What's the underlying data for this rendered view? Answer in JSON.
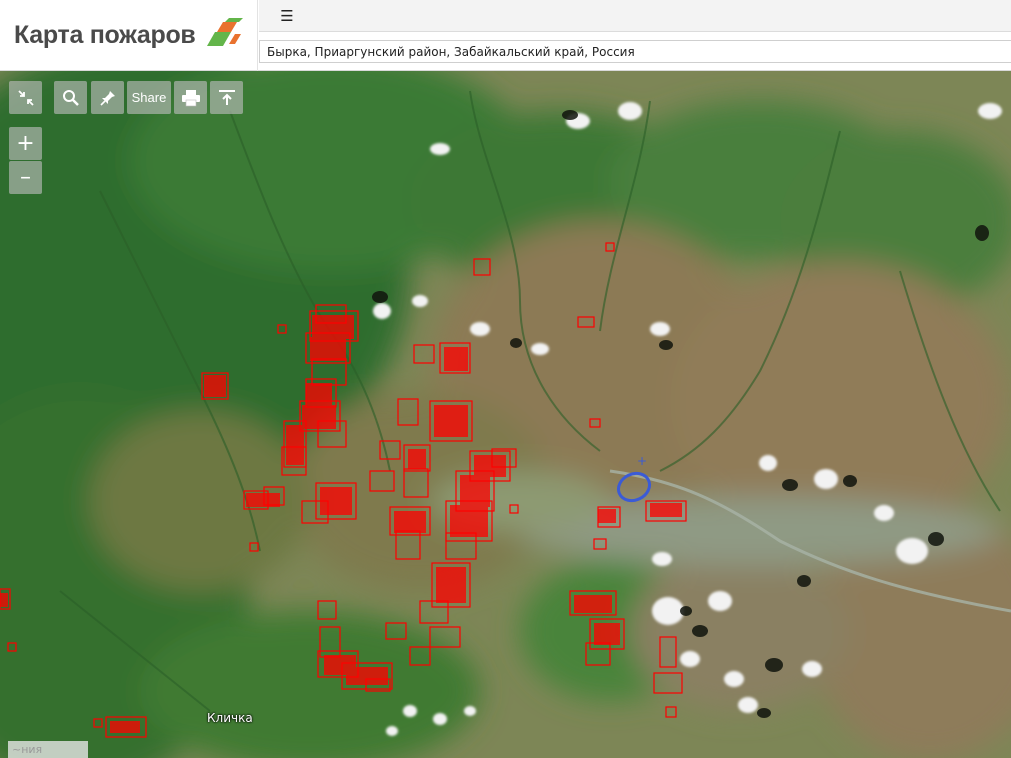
{
  "header": {
    "title": "Карта пожаров",
    "menu_icon": "☰",
    "location_value": "Бырка, Приаргунский район, Забайкальский край, Россия"
  },
  "toolbar": {
    "share_label": "Share",
    "zoom_in": "+",
    "zoom_out": "–"
  },
  "map": {
    "place_label": "Кличка",
    "corner_text": "~ния"
  },
  "colors": {
    "fire": "#ff0000",
    "brand_green": "#63b54a",
    "brand_orange": "#e9722e"
  }
}
